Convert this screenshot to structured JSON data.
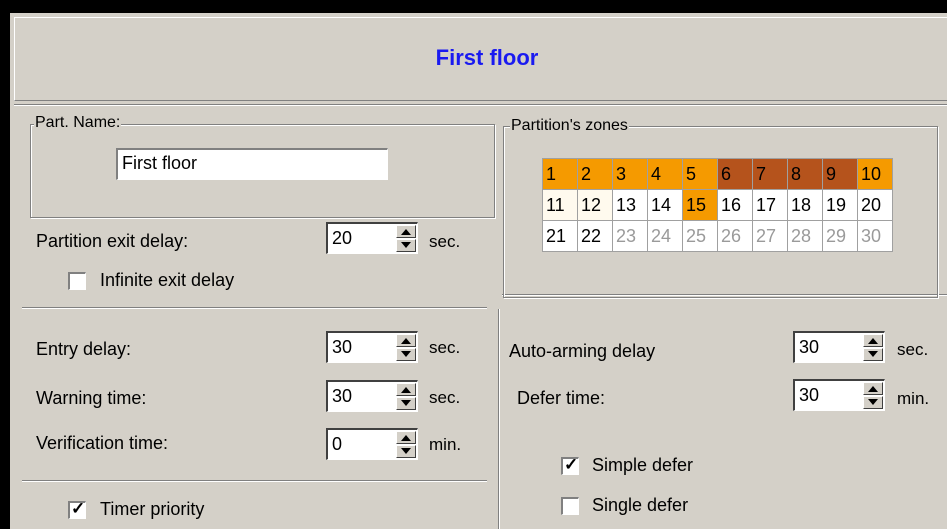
{
  "title": "First floor",
  "part_name": {
    "label": "Part. Name:",
    "value": "First floor"
  },
  "exit_delay": {
    "label": "Partition exit delay:",
    "value": "20",
    "unit": "sec."
  },
  "infinite_exit_delay": {
    "label": "Infinite exit delay",
    "checked": false
  },
  "entry_delay": {
    "label": "Entry delay:",
    "value": "30",
    "unit": "sec."
  },
  "warning_time": {
    "label": "Warning time:",
    "value": "30",
    "unit": "sec."
  },
  "verification_time": {
    "label": "Verification time:",
    "value": "0",
    "unit": "min."
  },
  "timer_priority": {
    "label": "Timer priority",
    "checked": true
  },
  "zones": {
    "label": "Partition's zones",
    "cells": [
      {
        "n": "1",
        "state": "orange"
      },
      {
        "n": "2",
        "state": "orange"
      },
      {
        "n": "3",
        "state": "orange"
      },
      {
        "n": "4",
        "state": "orange"
      },
      {
        "n": "5",
        "state": "orange"
      },
      {
        "n": "6",
        "state": "brown"
      },
      {
        "n": "7",
        "state": "brown"
      },
      {
        "n": "8",
        "state": "brown"
      },
      {
        "n": "9",
        "state": "brown"
      },
      {
        "n": "10",
        "state": "orange"
      },
      {
        "n": "11",
        "state": "cream"
      },
      {
        "n": "12",
        "state": "cream"
      },
      {
        "n": "13",
        "state": "white"
      },
      {
        "n": "14",
        "state": "white"
      },
      {
        "n": "15",
        "state": "orange"
      },
      {
        "n": "16",
        "state": "white"
      },
      {
        "n": "17",
        "state": "white"
      },
      {
        "n": "18",
        "state": "white"
      },
      {
        "n": "19",
        "state": "white"
      },
      {
        "n": "20",
        "state": "white"
      },
      {
        "n": "21",
        "state": "white"
      },
      {
        "n": "22",
        "state": "white"
      },
      {
        "n": "23",
        "state": "disabled"
      },
      {
        "n": "24",
        "state": "disabled"
      },
      {
        "n": "25",
        "state": "disabled"
      },
      {
        "n": "26",
        "state": "disabled"
      },
      {
        "n": "27",
        "state": "disabled"
      },
      {
        "n": "28",
        "state": "disabled"
      },
      {
        "n": "29",
        "state": "disabled"
      },
      {
        "n": "30",
        "state": "disabled"
      }
    ],
    "colors": {
      "orange": "#f59a00",
      "brown": "#b5531c",
      "cream": "#fffaee",
      "white": "#ffffff",
      "disabled": "#ffffff"
    }
  },
  "auto_arming_delay": {
    "label": "Auto-arming delay",
    "value": "30",
    "unit": "sec."
  },
  "defer_time": {
    "label": "Defer time:",
    "value": "30",
    "unit": "min."
  },
  "simple_defer": {
    "label": "Simple defer",
    "checked": true
  },
  "single_defer": {
    "label": "Single defer",
    "checked": false
  }
}
